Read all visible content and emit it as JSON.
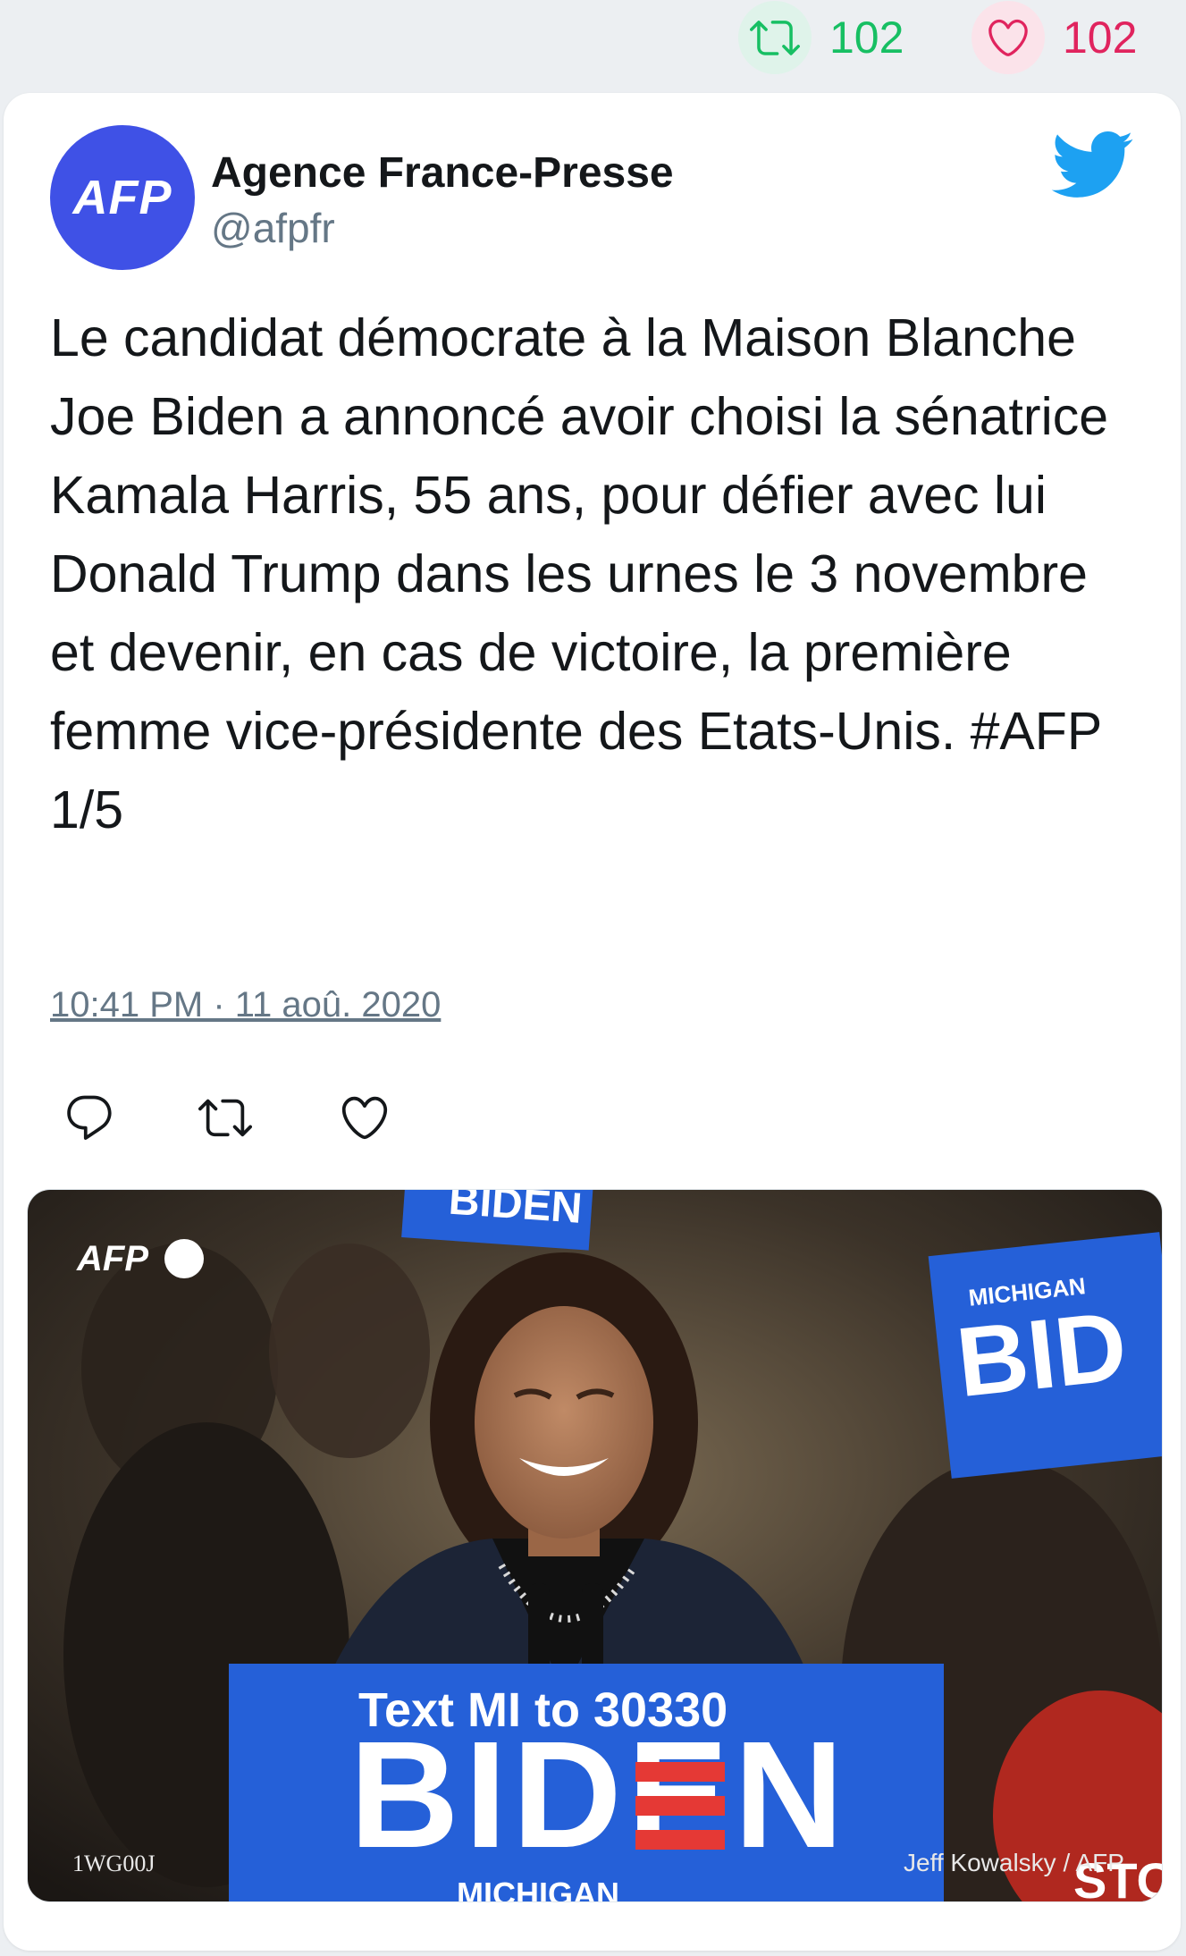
{
  "stats": {
    "retweet_count": "102",
    "like_count": "102"
  },
  "author": {
    "avatar_text": "AFP",
    "name": "Agence France-Presse",
    "handle": "@afpfr"
  },
  "tweet": {
    "text": "Le candidat démocrate à la Maison Blanche Joe Biden a annoncé avoir choisi la sénatrice Kamala Harris, 55 ans, pour défier avec lui Donald Trump dans les urnes le 3 novembre et devenir, en cas de victoire, la première femme vice-présidente des Etats-Unis. #AFP 1/5",
    "timestamp": "10:41 PM · 11 aoû. 2020"
  },
  "actions": [
    "reply-icon",
    "retweet-icon",
    "like-icon"
  ],
  "photo": {
    "watermark": "AFP",
    "podium_line1": "Text MI to 30330",
    "podium_line2": "BIDEN",
    "podium_line3": "MICHIGAN",
    "sign_text": "BID",
    "sign_top_text": "MICHIGAN",
    "banner_top_text": "BIDEN",
    "red_sign_text": "STO",
    "photo_id": "1WG00J",
    "credit": "Jeff Kowalsky / AFP"
  },
  "colors": {
    "twitter_blue": "#1da1f2",
    "retweet_green": "#17bf63",
    "like_red": "#e0245e",
    "afp_blue": "#3f51e6",
    "podium_blue": "#2560d8",
    "biden_red": "#e53935"
  }
}
